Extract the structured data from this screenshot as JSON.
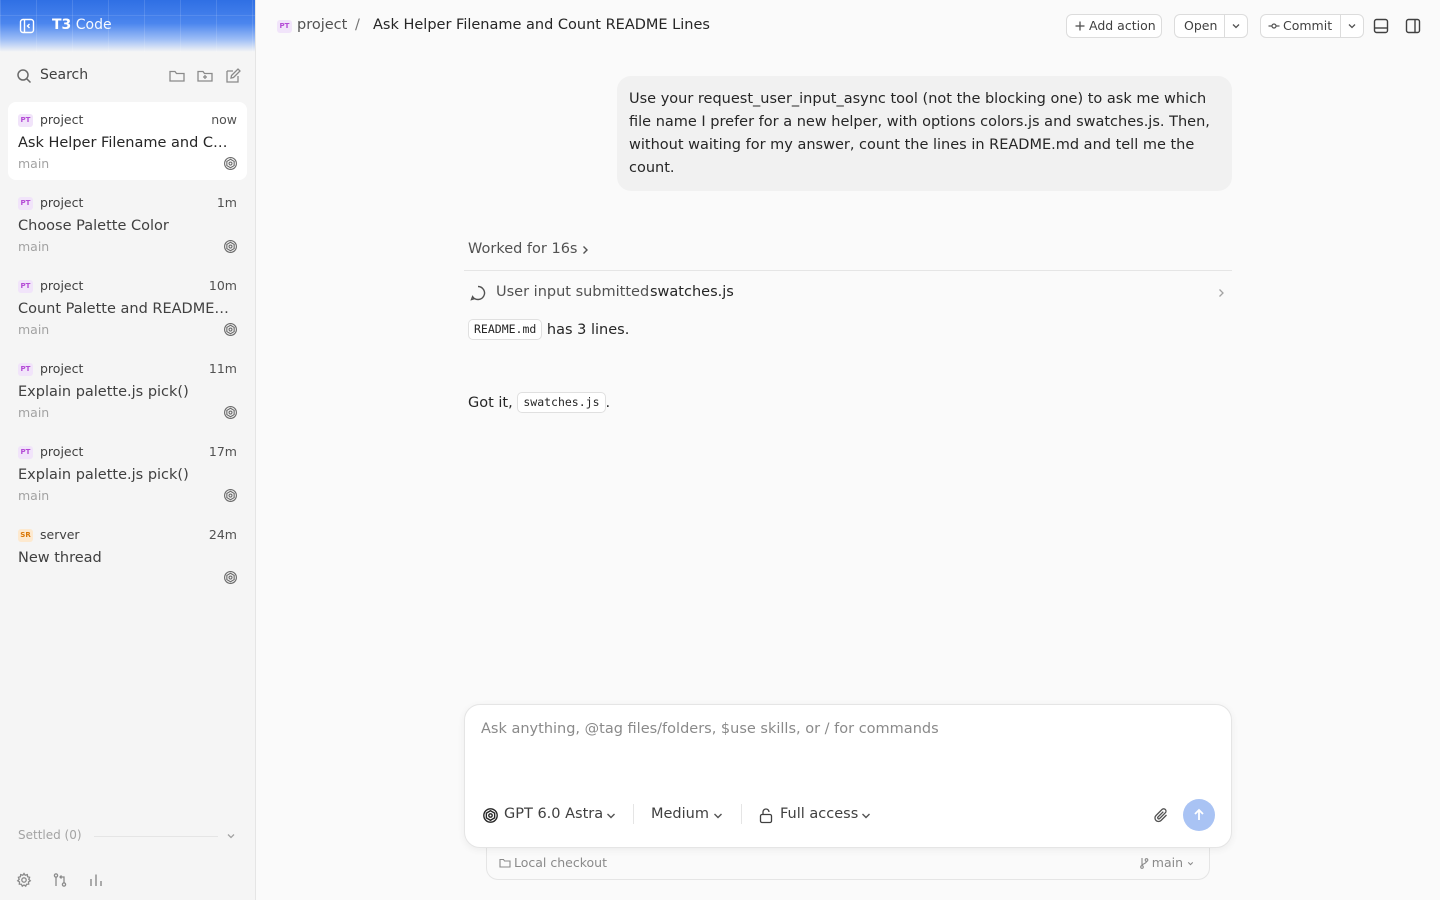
{
  "brand": {
    "bold": "T3",
    "light": "Code"
  },
  "sidebar": {
    "search_label": "Search",
    "threads": [
      {
        "badge": "PT",
        "project": "project",
        "time": "now",
        "title": "Ask Helper Filename and Count README Lines",
        "branch": "main"
      },
      {
        "badge": "PT",
        "project": "project",
        "time": "1m",
        "title": "Choose Palette Color",
        "branch": "main"
      },
      {
        "badge": "PT",
        "project": "project",
        "time": "10m",
        "title": "Count Palette and README Lines",
        "branch": "main"
      },
      {
        "badge": "PT",
        "project": "project",
        "time": "11m",
        "title": "Explain palette.js pick()",
        "branch": "main"
      },
      {
        "badge": "PT",
        "project": "project",
        "time": "17m",
        "title": "Explain palette.js pick()",
        "branch": "main"
      },
      {
        "badge": "SR",
        "project": "server",
        "time": "24m",
        "title": "New thread",
        "branch": ""
      }
    ],
    "settled_label": "Settled (0)"
  },
  "header": {
    "badge": "PT",
    "project": "project",
    "separator": "/",
    "title": "Ask Helper Filename and Count README Lines",
    "add_action": "Add action",
    "open": "Open",
    "commit": "Commit"
  },
  "conversation": {
    "user_message": "Use your request_user_input_async tool (not the blocking one) to ask me which file name I prefer for a new helper, with options colors.js and swatches.js. Then, without waiting for my answer, count the lines in README.md and tell me the count.",
    "worked": "Worked for 16s",
    "tool_label": "User input submitted",
    "tool_value": "swatches.js",
    "resp1_code": "README.md",
    "resp1_text": " has 3 lines.",
    "resp2_prefix": "Got it, ",
    "resp2_code": "swatches.js",
    "resp2_suffix": "."
  },
  "composer": {
    "placeholder": "Ask anything, @tag files/folders, $use skills, or / for commands",
    "model": "GPT 6.0 Astra",
    "effort": "Medium",
    "access": "Full access",
    "checkout": "Local checkout",
    "branch": "main"
  },
  "colors": {
    "accent": "#2f6fe4",
    "send_button": "#a9c3f4",
    "project_badge": "#b44bd6",
    "server_badge": "#d97706"
  }
}
